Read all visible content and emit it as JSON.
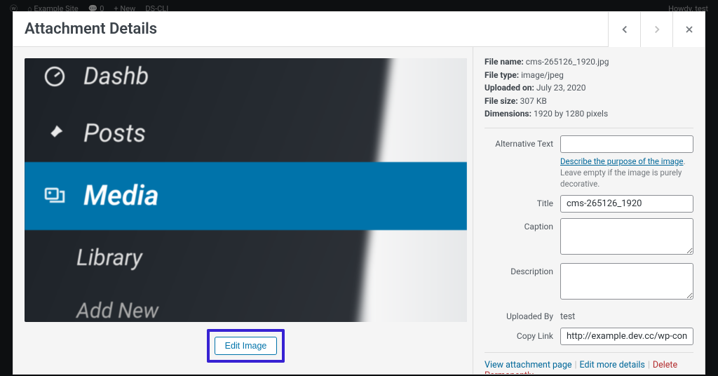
{
  "adminbar": {
    "site_name": "Example Site",
    "comments": "0",
    "new_label": "New",
    "dscli": "DS-CLI",
    "howdy": "Howdy, test"
  },
  "modal": {
    "title": "Attachment Details",
    "edit_image": "Edit Image"
  },
  "photo_menu": {
    "dashboard": "Dashb",
    "posts": "Posts",
    "media": "Media",
    "library": "Library",
    "add_new": "Add New"
  },
  "meta": {
    "filename_label": "File name:",
    "filename": "cms-265126_1920.jpg",
    "filetype_label": "File type:",
    "filetype": "image/jpeg",
    "uploaded_label": "Uploaded on:",
    "uploaded": "July 23, 2020",
    "filesize_label": "File size:",
    "filesize": "307 KB",
    "dimensions_label": "Dimensions:",
    "dimensions": "1920 by 1280 pixels"
  },
  "fields": {
    "alt_label": "Alternative Text",
    "alt_value": "",
    "alt_hint_link": "Describe the purpose of the image",
    "alt_hint_rest": ". Leave empty if the image is purely decorative.",
    "title_label": "Title",
    "title_value": "cms-265126_1920",
    "caption_label": "Caption",
    "caption_value": "",
    "description_label": "Description",
    "description_value": "",
    "uploadedby_label": "Uploaded By",
    "uploadedby_value": "test",
    "copylink_label": "Copy Link",
    "copylink_value": "http://example.dev.cc/wp-content/upl"
  },
  "actions": {
    "view": "View attachment page",
    "edit": "Edit more details",
    "delete": "Delete Permanently"
  }
}
